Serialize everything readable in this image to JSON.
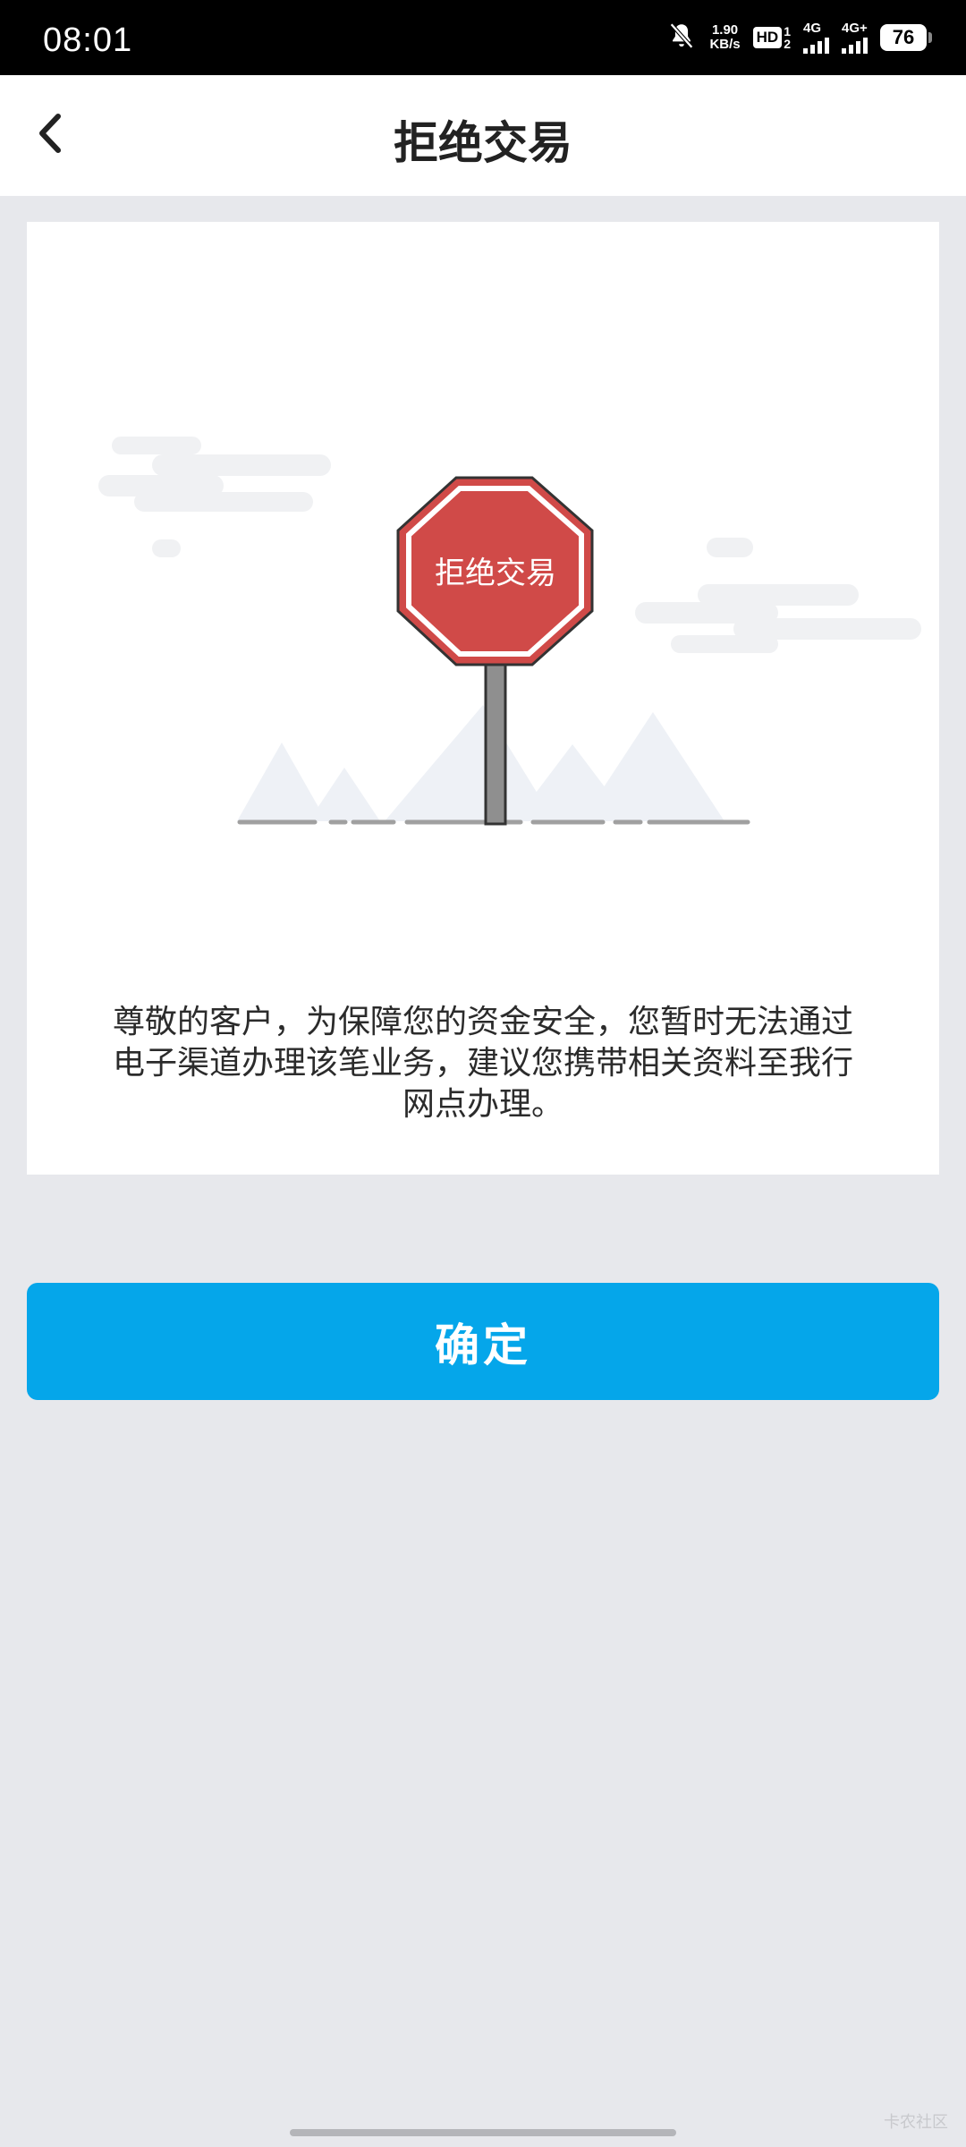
{
  "status_bar": {
    "time": "08:01",
    "net_speed_value": "1.90",
    "net_speed_unit": "KB/s",
    "hd_label": "HD",
    "hd_sub_top": "1",
    "hd_sub_bottom": "2",
    "signal1_label": "4G",
    "signal2_label": "4G+",
    "battery": "76",
    "icons": [
      "mute-bell-icon",
      "hd-voice-icon",
      "signal-icon",
      "battery-icon"
    ]
  },
  "nav": {
    "title": "拒绝交易",
    "back_icon": "chevron-left-icon"
  },
  "illustration": {
    "sign_text": "拒绝交易",
    "colors": {
      "sign_red": "#d04a48",
      "pole_gray": "#8f8f8f",
      "cloud": "#f0f1f3",
      "mountain": "#eef1f6",
      "ground": "#a0a0a0"
    }
  },
  "message": {
    "lines": [
      "尊敬的客户，为保障您的资金安全，您暂时无法通过",
      "电子渠道办理该笔业务，建议您携带相关资料至我行",
      "网点办理。"
    ]
  },
  "confirm": {
    "label": "确定",
    "color": "#05a6ea"
  },
  "watermark": "卡农社区"
}
